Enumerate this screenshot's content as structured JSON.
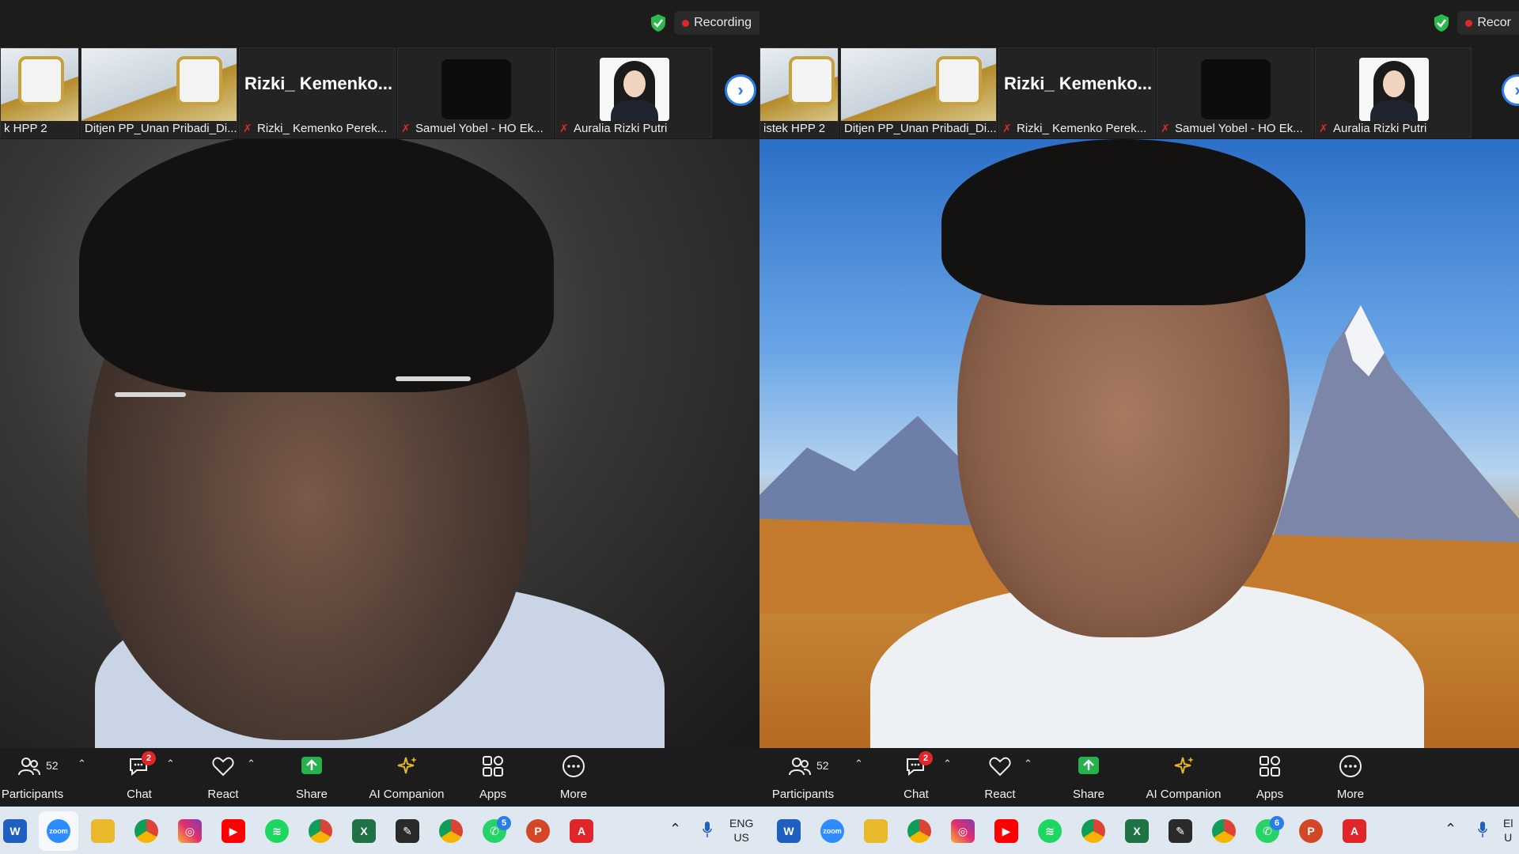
{
  "panels": [
    {
      "id": "left",
      "recording_label": "Recording",
      "thumbnails": {
        "partial_name": "k HPP 2",
        "tile2_name": "Ditjen PP_Unan Pribadi_Di...",
        "tile3_title": "Rizki_  Kemenko...",
        "tile3_name": "Rizki_ Kemenko Perek...",
        "tile4_name": "Samuel Yobel - HO Ek...",
        "tile5_name": "Auralia Rizki Putri"
      },
      "toolbar": {
        "participants_count": "52",
        "participants_label": "Participants",
        "chat_label": "Chat",
        "chat_badge": "2",
        "react_label": "React",
        "share_label": "Share",
        "ai_label": "AI Companion",
        "apps_label": "Apps",
        "more_label": "More"
      },
      "taskbar": {
        "whatsapp_badge": "5",
        "lang_line1": "ENG",
        "lang_line2": "US"
      }
    },
    {
      "id": "right",
      "recording_label": "Recor",
      "thumbnails": {
        "partial_name": "istek HPP 2",
        "tile2_name": "Ditjen PP_Unan Pribadi_Di...",
        "tile3_title": "Rizki_  Kemenko...",
        "tile3_name": "Rizki_ Kemenko Perek...",
        "tile4_name": "Samuel Yobel - HO Ek...",
        "tile5_name": "Auralia Rizki Putri"
      },
      "toolbar": {
        "participants_count": "52",
        "participants_label": "Participants",
        "chat_label": "Chat",
        "chat_badge": "2",
        "react_label": "React",
        "share_label": "Share",
        "ai_label": "AI Companion",
        "apps_label": "Apps",
        "more_label": "More"
      },
      "taskbar": {
        "whatsapp_badge": "6",
        "lang_line1": "El",
        "lang_line2": "U"
      }
    }
  ],
  "colors": {
    "toolbar_bg": "#1c1c1c",
    "recording_red": "#e0262b",
    "shield_green": "#2db84d",
    "share_green": "#25b14b",
    "taskbar_bg": "#dfe7f1",
    "accent_blue": "#2b7de9"
  },
  "icons": {
    "participants": "participants-icon",
    "chat": "chat-bubble-icon",
    "react": "heart-icon",
    "share": "share-arrow-icon",
    "ai": "sparkle-icon",
    "apps": "apps-grid-icon",
    "more": "ellipsis-icon"
  }
}
